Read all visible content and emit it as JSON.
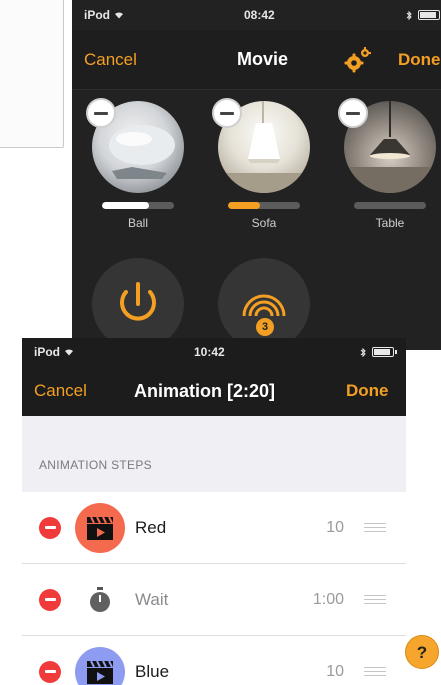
{
  "colors": {
    "accent": "#f39f23",
    "nav_dark": "#1c1c1c",
    "danger": "#f13a3a",
    "red_scene": "#f46a4e",
    "blue_scene": "#8d9cf0"
  },
  "back_screen": {
    "status": {
      "carrier": "iPod",
      "time": "08:42",
      "battery_level": 0.9
    },
    "nav": {
      "cancel_label": "Cancel",
      "title": "Movie",
      "done_label": "Done",
      "settings_icon": "gear-icon"
    },
    "lamps": [
      {
        "label": "Ball",
        "level": 0.65,
        "level_color": "#ffffff"
      },
      {
        "label": "Sofa",
        "level": 0.45,
        "level_color": "#f39f23"
      },
      {
        "label": "Table",
        "level": 0.0,
        "level_color": "#5c5c5c"
      }
    ],
    "actions": [
      {
        "icon": "power-icon"
      },
      {
        "icon": "scene-broadcast-icon",
        "count": "3"
      }
    ]
  },
  "front_screen": {
    "status": {
      "carrier": "iPod",
      "time": "10:42",
      "battery_level": 0.9
    },
    "nav": {
      "cancel_label": "Cancel",
      "title": "Animation [2:20]",
      "done_label": "Done"
    },
    "section_header": "ANIMATION STEPS",
    "steps": [
      {
        "name": "Red",
        "duration": "10",
        "icon": "clapperboard-icon"
      },
      {
        "name": "Wait",
        "duration": "1:00",
        "icon": "stopwatch-icon"
      },
      {
        "name": "Blue",
        "duration": "10",
        "icon": "clapperboard-icon"
      }
    ]
  },
  "help_button": {
    "label": "?"
  }
}
